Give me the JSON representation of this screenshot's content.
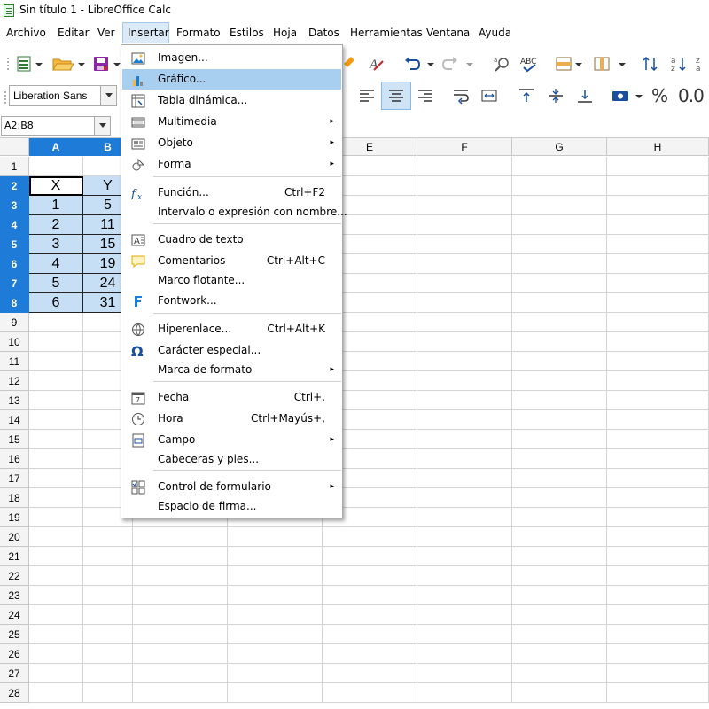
{
  "window": {
    "title": "Sin título 1 - LibreOffice Calc"
  },
  "menubar": [
    {
      "id": "archivo",
      "label": "Archivo"
    },
    {
      "id": "editar",
      "label": "Editar"
    },
    {
      "id": "ver",
      "label": "Ver"
    },
    {
      "id": "insertar",
      "label": "Insertar"
    },
    {
      "id": "formato",
      "label": "Formato"
    },
    {
      "id": "estilos",
      "label": "Estilos"
    },
    {
      "id": "hoja",
      "label": "Hoja"
    },
    {
      "id": "datos",
      "label": "Datos"
    },
    {
      "id": "herramientas",
      "label": "Herramientas"
    },
    {
      "id": "ventana",
      "label": "Ventana"
    },
    {
      "id": "ayuda",
      "label": "Ayuda"
    }
  ],
  "formatbar": {
    "font_name": "Liberation Sans"
  },
  "name_box": {
    "value": "A2:B8"
  },
  "sheet": {
    "columns": [
      "A",
      "B",
      "C",
      "D",
      "E",
      "F",
      "G",
      "H"
    ],
    "rows": [
      "1",
      "2",
      "3",
      "4",
      "5",
      "6",
      "7",
      "8",
      "9",
      "10",
      "11",
      "12",
      "13",
      "14",
      "15",
      "16",
      "17",
      "18",
      "19",
      "20",
      "21",
      "22",
      "23",
      "24",
      "25",
      "26",
      "27",
      "28"
    ],
    "cells": {
      "A2": "X",
      "B2": "Y",
      "A3": "1",
      "B3": "5",
      "A4": "2",
      "B4": "11",
      "A5": "3",
      "B5": "15",
      "A6": "4",
      "B6": "19",
      "A7": "5",
      "B7": "24",
      "A8": "6",
      "B8": "31"
    }
  },
  "insert_menu": {
    "items": [
      {
        "label": "Imagen...",
        "icon": "image-icon",
        "shortcut": "",
        "submenu": false
      },
      {
        "label": "Gráfico...",
        "icon": "chart-icon",
        "shortcut": "",
        "submenu": false,
        "highlighted": true
      },
      {
        "label": "Tabla dinámica...",
        "icon": "pivot-table-icon",
        "shortcut": "",
        "submenu": false
      },
      {
        "label": "Multimedia",
        "icon": "multimedia-icon",
        "shortcut": "",
        "submenu": true
      },
      {
        "label": "Objeto",
        "icon": "object-icon",
        "shortcut": "",
        "submenu": true
      },
      {
        "label": "Forma",
        "icon": "shape-icon",
        "shortcut": "",
        "submenu": true
      },
      {
        "label": "Función...",
        "icon": "function-icon",
        "shortcut": "Ctrl+F2",
        "submenu": false
      },
      {
        "label": "Intervalo o expresión con nombre...",
        "icon": "",
        "shortcut": "",
        "submenu": false
      },
      {
        "label": "Cuadro de texto",
        "icon": "text-box-icon",
        "shortcut": "",
        "submenu": false
      },
      {
        "label": "Comentarios",
        "icon": "comment-icon",
        "shortcut": "Ctrl+Alt+C",
        "submenu": false
      },
      {
        "label": "Marco flotante...",
        "icon": "",
        "shortcut": "",
        "submenu": false
      },
      {
        "label": "Fontwork...",
        "icon": "fontwork-icon",
        "shortcut": "",
        "submenu": false
      },
      {
        "label": "Hiperenlace...",
        "icon": "hyperlink-icon",
        "shortcut": "Ctrl+Alt+K",
        "submenu": false
      },
      {
        "label": "Carácter especial...",
        "icon": "omega-icon",
        "shortcut": "",
        "submenu": false
      },
      {
        "label": "Marca de formato",
        "icon": "",
        "shortcut": "",
        "submenu": true
      },
      {
        "label": "Fecha",
        "icon": "calendar-icon",
        "shortcut": "Ctrl+,",
        "submenu": false
      },
      {
        "label": "Hora",
        "icon": "clock-icon",
        "shortcut": "Ctrl+Mayús+,",
        "submenu": false
      },
      {
        "label": "Campo",
        "icon": "field-icon",
        "shortcut": "",
        "submenu": true
      },
      {
        "label": "Cabeceras y pies...",
        "icon": "",
        "shortcut": "",
        "submenu": false
      },
      {
        "label": "Control de formulario",
        "icon": "form-control-icon",
        "shortcut": "",
        "submenu": true
      },
      {
        "label": "Espacio de firma...",
        "icon": "",
        "shortcut": "",
        "submenu": false
      }
    ]
  },
  "colors": {
    "selection_header": "#1e7cd8",
    "selection_cell": "#c6dff5",
    "menu_highlight": "#a8cff0"
  }
}
